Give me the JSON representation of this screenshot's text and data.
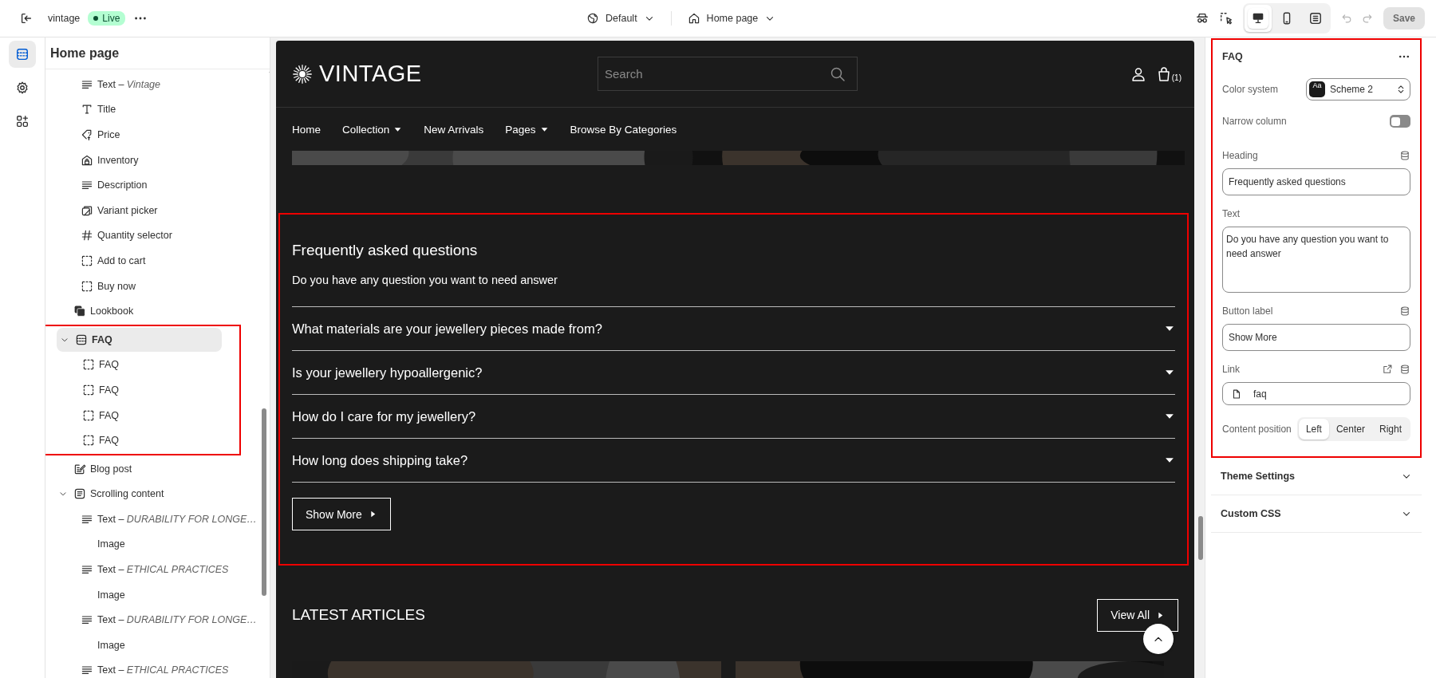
{
  "topbar": {
    "store": "vintage",
    "status": "Live",
    "theme": "Default",
    "page": "Home page",
    "view_modes": [
      {
        "kind": "desktop",
        "selected": true
      },
      {
        "kind": "mobile",
        "selected": false
      },
      {
        "kind": "fullscreen",
        "selected": false
      }
    ],
    "save": {
      "label": "Save",
      "disabled": true
    }
  },
  "rail": [
    {
      "kind": "sections",
      "selected": true
    },
    {
      "kind": "settings",
      "selected": false
    },
    {
      "kind": "apps",
      "selected": false
    }
  ],
  "sidebar": {
    "title": "Home page",
    "items": [
      {
        "children": [
          {
            "label": "Text – *Vintage*",
            "kind": "text",
            "selected": false
          },
          {
            "label": "Title",
            "kind": "title",
            "selected": false
          },
          {
            "label": "Price",
            "kind": "price",
            "selected": false
          },
          {
            "label": "Inventory",
            "kind": "inventory",
            "selected": false
          },
          {
            "label": "Description",
            "kind": "text",
            "selected": false
          },
          {
            "label": "Variant picker",
            "kind": "variant",
            "selected": false
          },
          {
            "label": "Quantity selector",
            "kind": "hash",
            "selected": false
          },
          {
            "label": "Add to cart",
            "kind": "block",
            "selected": false
          },
          {
            "label": "Buy now",
            "kind": "block",
            "selected": false
          }
        ]
      },
      {
        "label": "Lookbook",
        "kind": "lookbook",
        "selected": false
      },
      {
        "label": "FAQ",
        "kind": "section",
        "selected": true,
        "expanded": true,
        "highlighted": true,
        "children": [
          {
            "label": "FAQ",
            "kind": "block",
            "selected": false
          },
          {
            "label": "FAQ",
            "kind": "block",
            "selected": false
          },
          {
            "label": "FAQ",
            "kind": "block",
            "selected": false
          },
          {
            "label": "FAQ",
            "kind": "block",
            "selected": false
          }
        ]
      },
      {
        "label": "Blog post",
        "kind": "blog",
        "selected": false
      },
      {
        "label": "Scrolling content",
        "kind": "doc",
        "selected": false,
        "expanded": true,
        "children": [
          {
            "label": "Text – *DURABILITY FOR LONGE…*",
            "kind": "text",
            "selected": false
          },
          {
            "label": "Image",
            "selected": false
          },
          {
            "label": "Text – *ETHICAL PRACTICES*",
            "kind": "text",
            "selected": false
          },
          {
            "label": "Image",
            "selected": false
          },
          {
            "label": "Text – *DURABILITY FOR LONGE…*",
            "kind": "text",
            "selected": false
          },
          {
            "label": "Image",
            "selected": false
          },
          {
            "label": "Text – *ETHICAL PRACTICES*",
            "kind": "text",
            "selected": false
          }
        ]
      }
    ]
  },
  "preview": {
    "logo": "VINTAGE",
    "search": {
      "placeholder": "Search"
    },
    "cart_count": "(1)",
    "nav": [
      {
        "label": "Home",
        "dropdown": false
      },
      {
        "label": "Collection",
        "dropdown": true
      },
      {
        "label": "New Arrivals",
        "dropdown": false
      },
      {
        "label": "Pages",
        "dropdown": true
      },
      {
        "label": "Browse By Categories",
        "dropdown": false
      }
    ],
    "faq": {
      "highlighted": true,
      "heading": "Frequently asked questions",
      "text": "Do you have any question you want to need answer",
      "questions": [
        {
          "label": "What materials are your jewellery pieces made from?",
          "expanded": false
        },
        {
          "label": "Is your jewellery hypoallergenic?",
          "expanded": false
        },
        {
          "label": "How do I care for my jewellery?",
          "expanded": false
        },
        {
          "label": "How long does shipping take?",
          "expanded": false
        }
      ],
      "button": "Show More"
    },
    "articles": {
      "title": "LATEST ARTICLES",
      "view_all": "View All"
    }
  },
  "settings": {
    "title": "FAQ",
    "highlighted": true,
    "color_system": {
      "label": "Color system",
      "swatch": "Aa",
      "value": "Scheme 2"
    },
    "narrow_column": {
      "label": "Narrow column",
      "on": false
    },
    "heading": {
      "label": "Heading",
      "value": "Frequently asked questions"
    },
    "text": {
      "label": "Text",
      "value": "Do you have any question you want to need answer"
    },
    "button_label": {
      "label": "Button label",
      "value": "Show More"
    },
    "link": {
      "label": "Link",
      "value": "faq"
    },
    "content_position": {
      "label": "Content position",
      "options": [
        {
          "label": "Left",
          "selected": true
        },
        {
          "label": "Center",
          "selected": false
        },
        {
          "label": "Right",
          "selected": false
        }
      ]
    },
    "sections": [
      {
        "label": "Theme Settings",
        "expanded": false
      },
      {
        "label": "Custom CSS",
        "expanded": false
      }
    ]
  }
}
